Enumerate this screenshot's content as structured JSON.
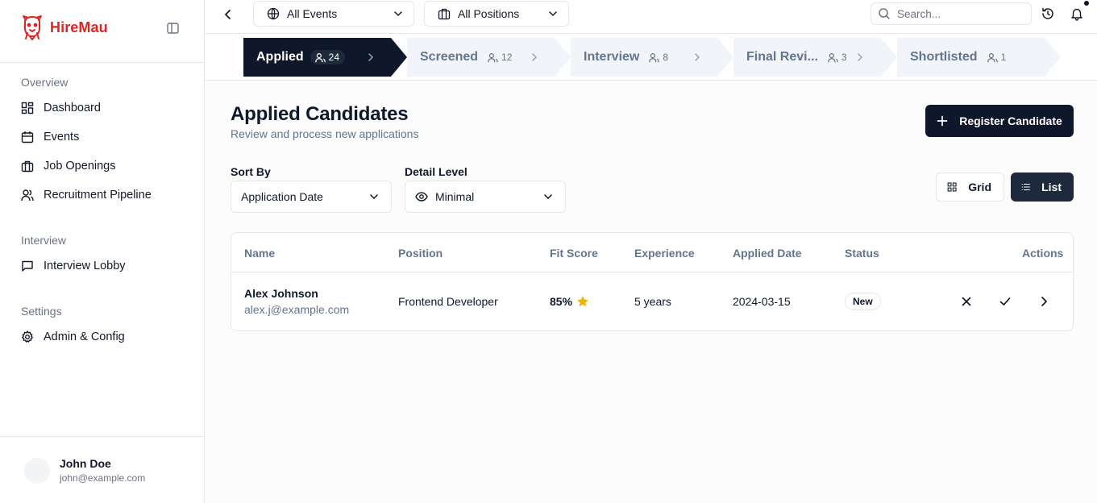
{
  "brand": {
    "name": "HireMau"
  },
  "sidebar": {
    "sections": [
      {
        "title": "Overview",
        "items": [
          {
            "label": "Dashboard",
            "icon": "dashboard-icon"
          },
          {
            "label": "Events",
            "icon": "calendar-icon"
          },
          {
            "label": "Job Openings",
            "icon": "briefcase-icon"
          },
          {
            "label": "Recruitment Pipeline",
            "icon": "users-icon"
          }
        ]
      },
      {
        "title": "Interview",
        "items": [
          {
            "label": "Interview Lobby",
            "icon": "message-square-icon"
          }
        ]
      },
      {
        "title": "Settings",
        "items": [
          {
            "label": "Admin & Config",
            "icon": "gear-icon"
          }
        ]
      }
    ],
    "user": {
      "name": "John Doe",
      "email": "john@example.com"
    }
  },
  "topbar": {
    "events_filter": "All Events",
    "positions_filter": "All Positions",
    "search_placeholder": "Search..."
  },
  "stages": [
    {
      "label": "Applied",
      "count": "24",
      "active": true
    },
    {
      "label": "Screened",
      "count": "12",
      "active": false
    },
    {
      "label": "Interview",
      "count": "8",
      "active": false
    },
    {
      "label": "Final Revi...",
      "count": "3",
      "active": false
    },
    {
      "label": "Shortlisted",
      "count": "1",
      "active": false
    }
  ],
  "main": {
    "title": "Applied Candidates",
    "subtitle": "Review and process new applications",
    "register_label": "Register Candidate",
    "sort_by_label": "Sort By",
    "sort_by_value": "Application Date",
    "detail_level_label": "Detail Level",
    "detail_level_value": "Minimal",
    "view_grid_label": "Grid",
    "view_list_label": "List",
    "active_view": "List"
  },
  "table": {
    "columns": [
      "Name",
      "Position",
      "Fit Score",
      "Experience",
      "Applied Date",
      "Status",
      "Actions"
    ],
    "rows": [
      {
        "name": "Alex Johnson",
        "email": "alex.j@example.com",
        "position": "Frontend Developer",
        "fit_score": "85%",
        "experience": "5 years",
        "applied_date": "2024-03-15",
        "status": "New"
      }
    ]
  },
  "colors": {
    "brand": "#dc2626",
    "primary": "#0f172a",
    "muted": "#64748b",
    "border": "#e5e7eb",
    "star": "#eab308"
  }
}
